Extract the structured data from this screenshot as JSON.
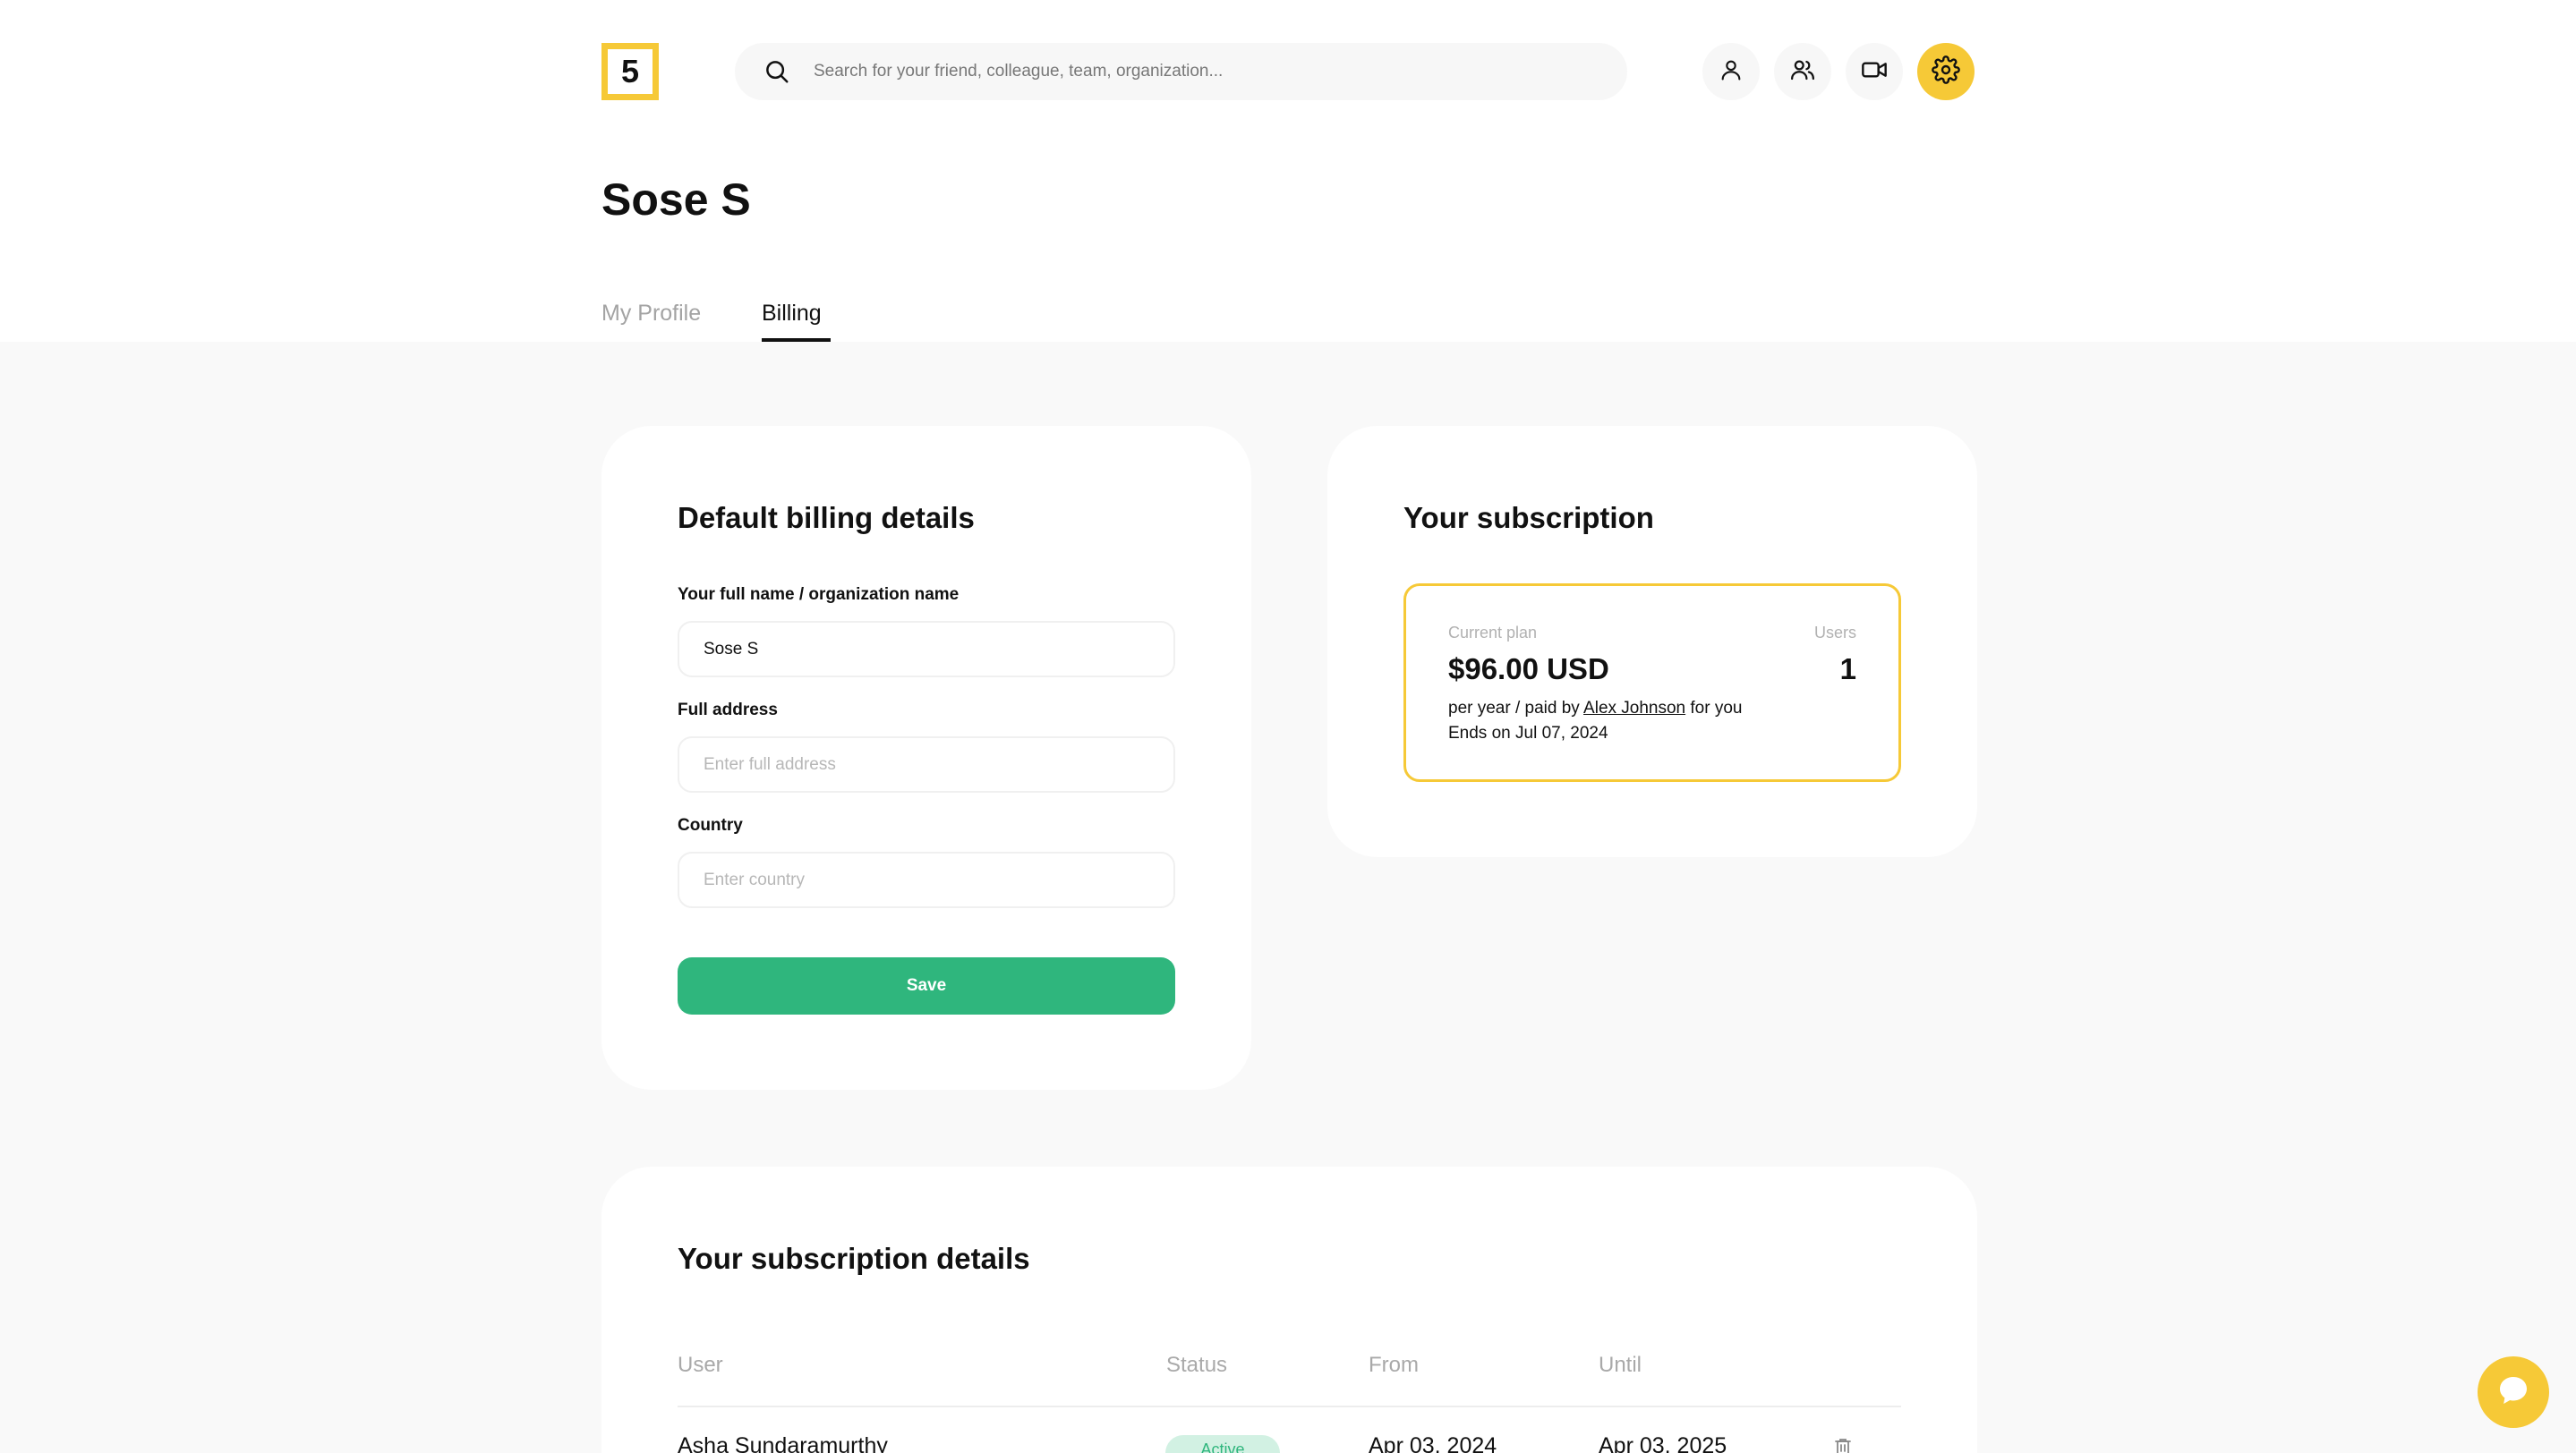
{
  "header": {
    "logo_text": "5",
    "search_placeholder": "Search for your friend, colleague, team, organization...",
    "icons": [
      "search-icon",
      "user-icon",
      "users-icon",
      "video-icon",
      "gear-icon"
    ],
    "accent_color": "#f6c937"
  },
  "page": {
    "title": "Sose S",
    "tabs": [
      {
        "label": "My Profile",
        "active": false
      },
      {
        "label": "Billing",
        "active": true
      }
    ]
  },
  "billing": {
    "title": "Default billing details",
    "name_label": "Your full name / organization name",
    "name_value": "Sose S",
    "address_label": "Full address",
    "address_placeholder": "Enter full address",
    "country_label": "Country",
    "country_placeholder": "Enter country",
    "save_label": "Save",
    "save_color": "#2fb67d"
  },
  "subscription": {
    "title": "Your subscription",
    "current_plan_label": "Current plan",
    "users_label": "Users",
    "price": "$96.00 USD",
    "users_count": "1",
    "period_prefix": "per year / paid by",
    "payer": "Alex Johnson",
    "period_suffix": "for you",
    "ends": "Ends on Jul 07, 2024"
  },
  "details": {
    "title": "Your subscription details",
    "columns": [
      "User",
      "Status",
      "From",
      "Until"
    ],
    "rows": [
      {
        "user": "Asha Sundaramurthy",
        "status": "Active",
        "from": "Apr 03, 2024",
        "until": "Apr 03, 2025"
      }
    ]
  },
  "chat": {
    "icon": "chat-bubble-icon"
  }
}
